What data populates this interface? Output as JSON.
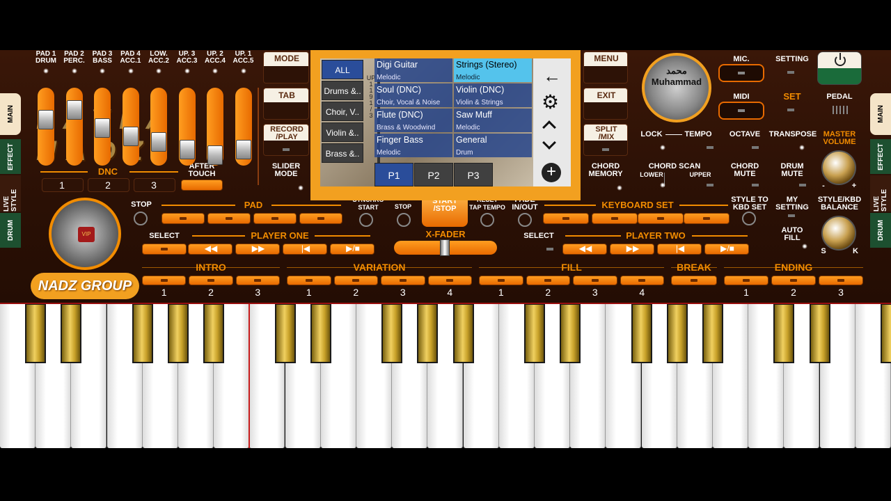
{
  "pad_sliders": [
    {
      "label": "PAD 1\nDRUM",
      "level": 0.75
    },
    {
      "label": "PAD 2\nPERC.",
      "level": 0.9
    },
    {
      "label": "PAD 3\nBASS",
      "level": 0.62
    },
    {
      "label": "PAD 4\nACC.1",
      "level": 0.5
    },
    {
      "label": "LOW.\nACC.2",
      "level": 0.42
    },
    {
      "label": "UP. 3\nACC.3",
      "level": 0.3
    },
    {
      "label": "UP. 2\nACC.4",
      "level": 0.22
    },
    {
      "label": "UP. 1\nACC.5",
      "level": 0.3
    }
  ],
  "watermark": "LAYLA NADZ",
  "left_buttons": {
    "mode": "MODE",
    "tab": "TAB",
    "record_play": "RECORD\n/PLAY",
    "slider_mode": "SLIDER\nMODE"
  },
  "dnc": {
    "label": "DNC",
    "buttons": [
      "1",
      "2",
      "3"
    ],
    "after_touch": "AFTER\nTOUCH"
  },
  "side_tabs_left": [
    "MAIN",
    "EFFECT",
    "LIVE\nSTYLE",
    "DRUM"
  ],
  "side_tabs_right": [
    "MAIN",
    "EFFECT",
    "LIVE\nSTYLE",
    "DRUM"
  ],
  "popup": {
    "categories": [
      "ALL",
      "Drums &..",
      "Choir, V..",
      "Violin &..",
      "Brass &.."
    ],
    "scroll_label": "UP\n1\n1\n9\n1\n/\n3",
    "sounds": [
      {
        "name": "Digi Guitar",
        "sub": "Melodic"
      },
      {
        "name": "Strings (Stereo)",
        "sub": "Melodic"
      },
      {
        "name": "Soul (DNC)",
        "sub": "Choir, Vocal & Noise"
      },
      {
        "name": "Violin (DNC)",
        "sub": "Violin & Strings"
      },
      {
        "name": "Flute (DNC)",
        "sub": "Brass & Woodwind"
      },
      {
        "name": "Saw Muff",
        "sub": "Melodic"
      },
      {
        "name": "Finger Bass",
        "sub": "Melodic"
      },
      {
        "name": "General",
        "sub": "Drum"
      }
    ],
    "pages": [
      "P1",
      "P2",
      "P3"
    ]
  },
  "right_menu": {
    "menu": "MENU",
    "exit": "EXIT",
    "split_mix": "SPLIT\n/MIX",
    "chord_memory": "CHORD\nMEMORY"
  },
  "avatar_text": "محمد\nMuhammad",
  "top_right": {
    "mic": "MIC.",
    "setting": "SETTING",
    "midi": "MIDI",
    "set": "SET",
    "pedal": "PEDAL"
  },
  "row_labels": {
    "lock": "LOCK",
    "tempo": "TEMPO",
    "octave": "OCTAVE",
    "transpose": "TRANSPOSE",
    "master_volume": "MASTER\nVOLUME",
    "chord_scan": "CHORD SCAN",
    "lower": "LOWER",
    "upper": "UPPER",
    "chord_mute": "CHORD\nMUTE",
    "drum_mute": "DRUM\nMUTE",
    "knob_minus": "-",
    "knob_plus": "+"
  },
  "transport": {
    "stop": "STOP",
    "pad": "PAD",
    "sync_start": "SYNCHRO\nSTART",
    "sync_stop": "STOP",
    "start_stop": "START\n/STOP",
    "reset": "RESET\nTAP TEMPO",
    "fade": "FADE\nIN/OUT",
    "keyboard_set": "KEYBOARD SET",
    "style_to_kbd": "STYLE TO\nKBD SET",
    "my_setting": "MY\nSETTING",
    "style_kbd_balance": "STYLE/KBD\nBALANCE",
    "auto_fill": "AUTO\nFILL",
    "bal_s": "S",
    "bal_k": "K"
  },
  "players": {
    "select": "SELECT",
    "player_one": "PLAYER ONE",
    "xfader": "X-FADER",
    "player_two": "PLAYER TWO",
    "controls": [
      "◀◀",
      "▶▶",
      "|◀",
      "▶/■"
    ]
  },
  "style_sections": [
    {
      "label": "INTRO",
      "buttons": [
        "1",
        "2",
        "3"
      ]
    },
    {
      "label": "VARIATION",
      "buttons": [
        "1",
        "2",
        "3",
        "4"
      ]
    },
    {
      "label": "FILL",
      "buttons": [
        "1",
        "2",
        "3",
        "4"
      ]
    },
    {
      "label": "BREAK",
      "buttons": [
        ""
      ]
    },
    {
      "label": "ENDING",
      "buttons": [
        "1",
        "2",
        "3"
      ]
    }
  ],
  "logo": {
    "vip": "VIP",
    "group": "NADZ GROUP"
  },
  "colors": {
    "accent": "#f28c00",
    "panel": "#2a1005",
    "popup_frame": "#f2a020",
    "power": "#1a6b3a"
  }
}
